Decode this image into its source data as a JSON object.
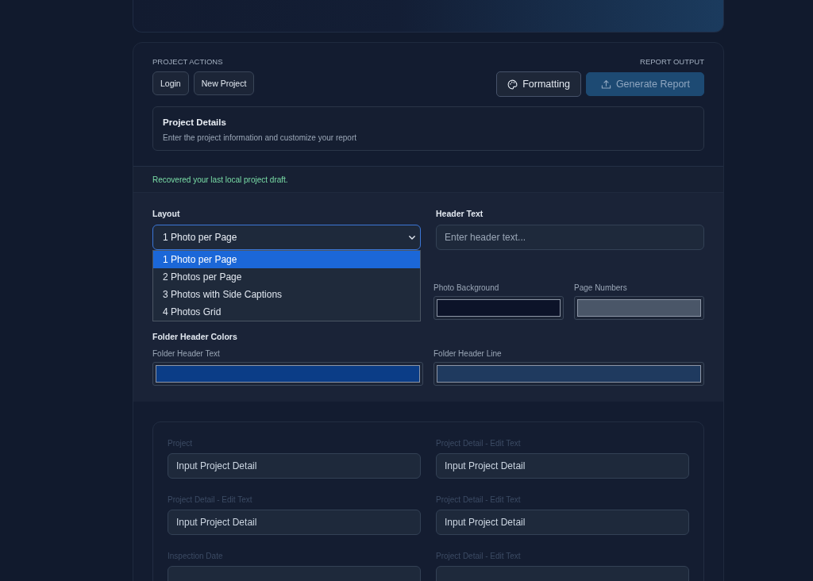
{
  "project_actions": {
    "label": "PROJECT ACTIONS",
    "buttons": [
      "Login",
      "New Project"
    ]
  },
  "report_output": {
    "label": "REPORT OUTPUT",
    "buttons": [
      {
        "label": "Formatting",
        "kind": "secondary",
        "disabled": false
      },
      {
        "label": "Generate Report",
        "kind": "primary",
        "disabled": true
      }
    ]
  },
  "project_details": {
    "title": "Project Details",
    "subtitle": "Enter the project information and customize your report"
  },
  "notice": "Recovered your last local project draft.",
  "layout": {
    "label": "Layout",
    "value": "1 Photo per Page",
    "expanded": true,
    "options": [
      {
        "label": "1 Photo per Page",
        "selected": true
      },
      {
        "label": "2 Photos per Page",
        "selected": false
      },
      {
        "label": "3 Photos with Side Captions",
        "selected": false
      },
      {
        "label": "4 Photos Grid",
        "selected": false
      }
    ]
  },
  "header_text": {
    "label": "Header Text",
    "placeholder": "Enter header text..."
  },
  "page_colors": [
    {
      "label": "Photo Background",
      "color": "#0c1329"
    },
    {
      "label": "Page Numbers",
      "color": "#4a5668"
    }
  ],
  "folder_header_colors": {
    "title": "Folder Header Colors",
    "fields": [
      {
        "label": "Folder Header Text",
        "color": "#0b3d87"
      },
      {
        "label": "Folder Header Line",
        "color": "#1f3a5f"
      }
    ]
  },
  "project_form": [
    {
      "label": "Project",
      "value": "Input Project Detail"
    },
    {
      "label": "Project Detail - Edit Text",
      "value": "Input Project Detail"
    },
    {
      "label": "Project Detail - Edit Text",
      "value": "Input Project Detail"
    },
    {
      "label": "Project Detail - Edit Text",
      "value": "Input Project Detail"
    },
    {
      "label": "Inspection Date"
    },
    {
      "label": "Project Detail - Edit Text"
    }
  ]
}
